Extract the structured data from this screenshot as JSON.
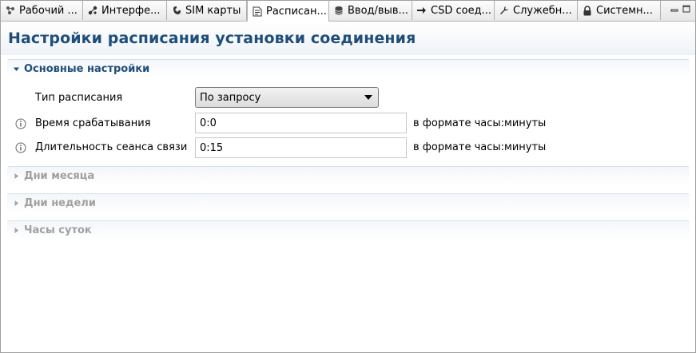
{
  "tabs": [
    {
      "label": "Рабочий ...",
      "icon": "workspace-icon",
      "active": false
    },
    {
      "label": "Интерфе...",
      "icon": "interface-icon",
      "active": false
    },
    {
      "label": "SIM карты",
      "icon": "sim-card-icon",
      "active": false
    },
    {
      "label": "Расписан...",
      "icon": "schedule-document-icon",
      "active": true
    },
    {
      "label": "Ввод/выв...",
      "icon": "database-icon",
      "active": false
    },
    {
      "label": "CSD соед...",
      "icon": "arrow-right-icon",
      "active": false
    },
    {
      "label": "Служебн...",
      "icon": "wrench-icon",
      "active": false
    },
    {
      "label": "Системн...",
      "icon": "lock-icon",
      "active": false
    }
  ],
  "page": {
    "title": "Настройки расписания установки соединения"
  },
  "sections": {
    "basic": {
      "title": "Основные настройки",
      "expanded": true
    },
    "month_days": {
      "title": "Дни месяца",
      "expanded": false
    },
    "week_days": {
      "title": "Дни недели",
      "expanded": false
    },
    "day_hours": {
      "title": "Часы суток",
      "expanded": false
    }
  },
  "form": {
    "schedule_type": {
      "label": "Тип расписания",
      "value": "По запросу"
    },
    "trigger_time": {
      "label": "Время срабатывания",
      "value": "0:0",
      "hint": "в формате часы:минуты"
    },
    "session_duration": {
      "label": "Длительность сеанса связи",
      "value": "0:15",
      "hint": "в формате часы:минуты"
    }
  },
  "colors": {
    "title": "#1f4e79",
    "collapsed_section": "#a0a0a0"
  }
}
